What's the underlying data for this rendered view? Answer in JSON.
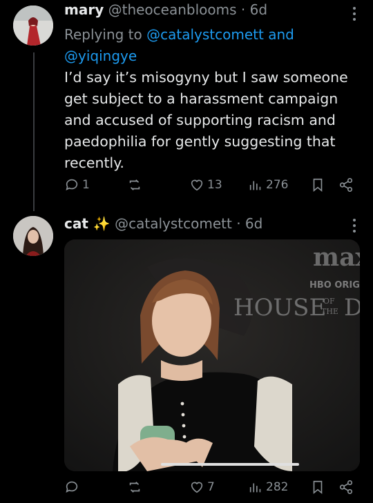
{
  "tweet1": {
    "name": "mary",
    "handle": "@theoceanblooms",
    "time": "· 6d",
    "replying_prefix": "Replying to",
    "reply_handle_1": "@catalystcomett",
    "reply_and": "and",
    "reply_handle_2": "@yiqingye",
    "text": "I’d say it’s misogyny but I saw someone get subject to a harassment campaign and accused of supporting racism and paedophilia for gently suggesting that recently.",
    "replies": "1",
    "retweets": "",
    "likes": "13",
    "views": "276"
  },
  "tweet2": {
    "name": "cat ✨",
    "handle": "@catalystcomett",
    "time": "· 6d",
    "media_text": {
      "brand": "max",
      "badge": "HBO ORIGI",
      "show": "HOUSE",
      "of": "OF",
      "the": "THE",
      "last_letter": "D"
    },
    "replies": "",
    "retweets": "",
    "likes": "7",
    "views": "282"
  },
  "icons": [
    "more-icon",
    "reply-icon",
    "retweet-icon",
    "like-icon",
    "views-icon",
    "bookmark-icon",
    "share-icon"
  ],
  "colors": {
    "background": "#000000",
    "text": "#e7e9ea",
    "muted": "#8b9196",
    "link": "#1d9bf0"
  }
}
